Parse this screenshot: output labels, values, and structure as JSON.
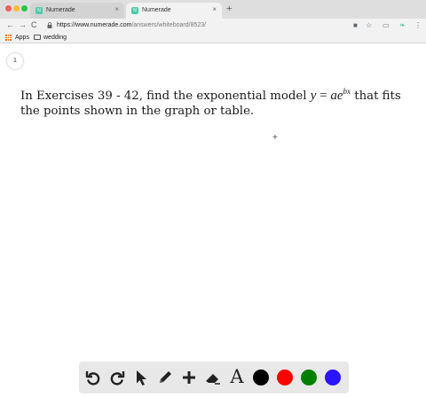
{
  "browser": {
    "tabs": [
      {
        "title": "Numerade",
        "favicon": "N",
        "close": "×"
      },
      {
        "title": "Numerade",
        "favicon": "N",
        "close": "×"
      }
    ],
    "new_tab": "+",
    "nav": {
      "back": "←",
      "forward": "→",
      "reload": "C"
    },
    "url": {
      "host": "https://www.numerade.com",
      "path": "/answers/whiteboard/8523/"
    },
    "bookmarks": [
      {
        "label": "Apps",
        "icon": "apps-grid-icon"
      },
      {
        "label": "wedding",
        "icon": "folder-icon"
      }
    ]
  },
  "page": {
    "page_number": "1",
    "problem": {
      "prefix": "In Exercises 39 - 42, find the exponential model ",
      "math_lhs": "y",
      "math_eq": " = ",
      "math_base": "ae",
      "math_exp": "bx",
      "suffix": " that fits the points shown in the graph or table."
    },
    "cursor": "+"
  },
  "drawing_toolbar": {
    "tools": [
      "undo-icon",
      "redo-icon",
      "pointer-icon",
      "pen-icon",
      "plus-icon",
      "eraser-icon",
      "text-icon"
    ],
    "text_tool_label": "A",
    "colors": [
      "#000000",
      "#ff0000",
      "#008000",
      "#2a14ff"
    ]
  }
}
